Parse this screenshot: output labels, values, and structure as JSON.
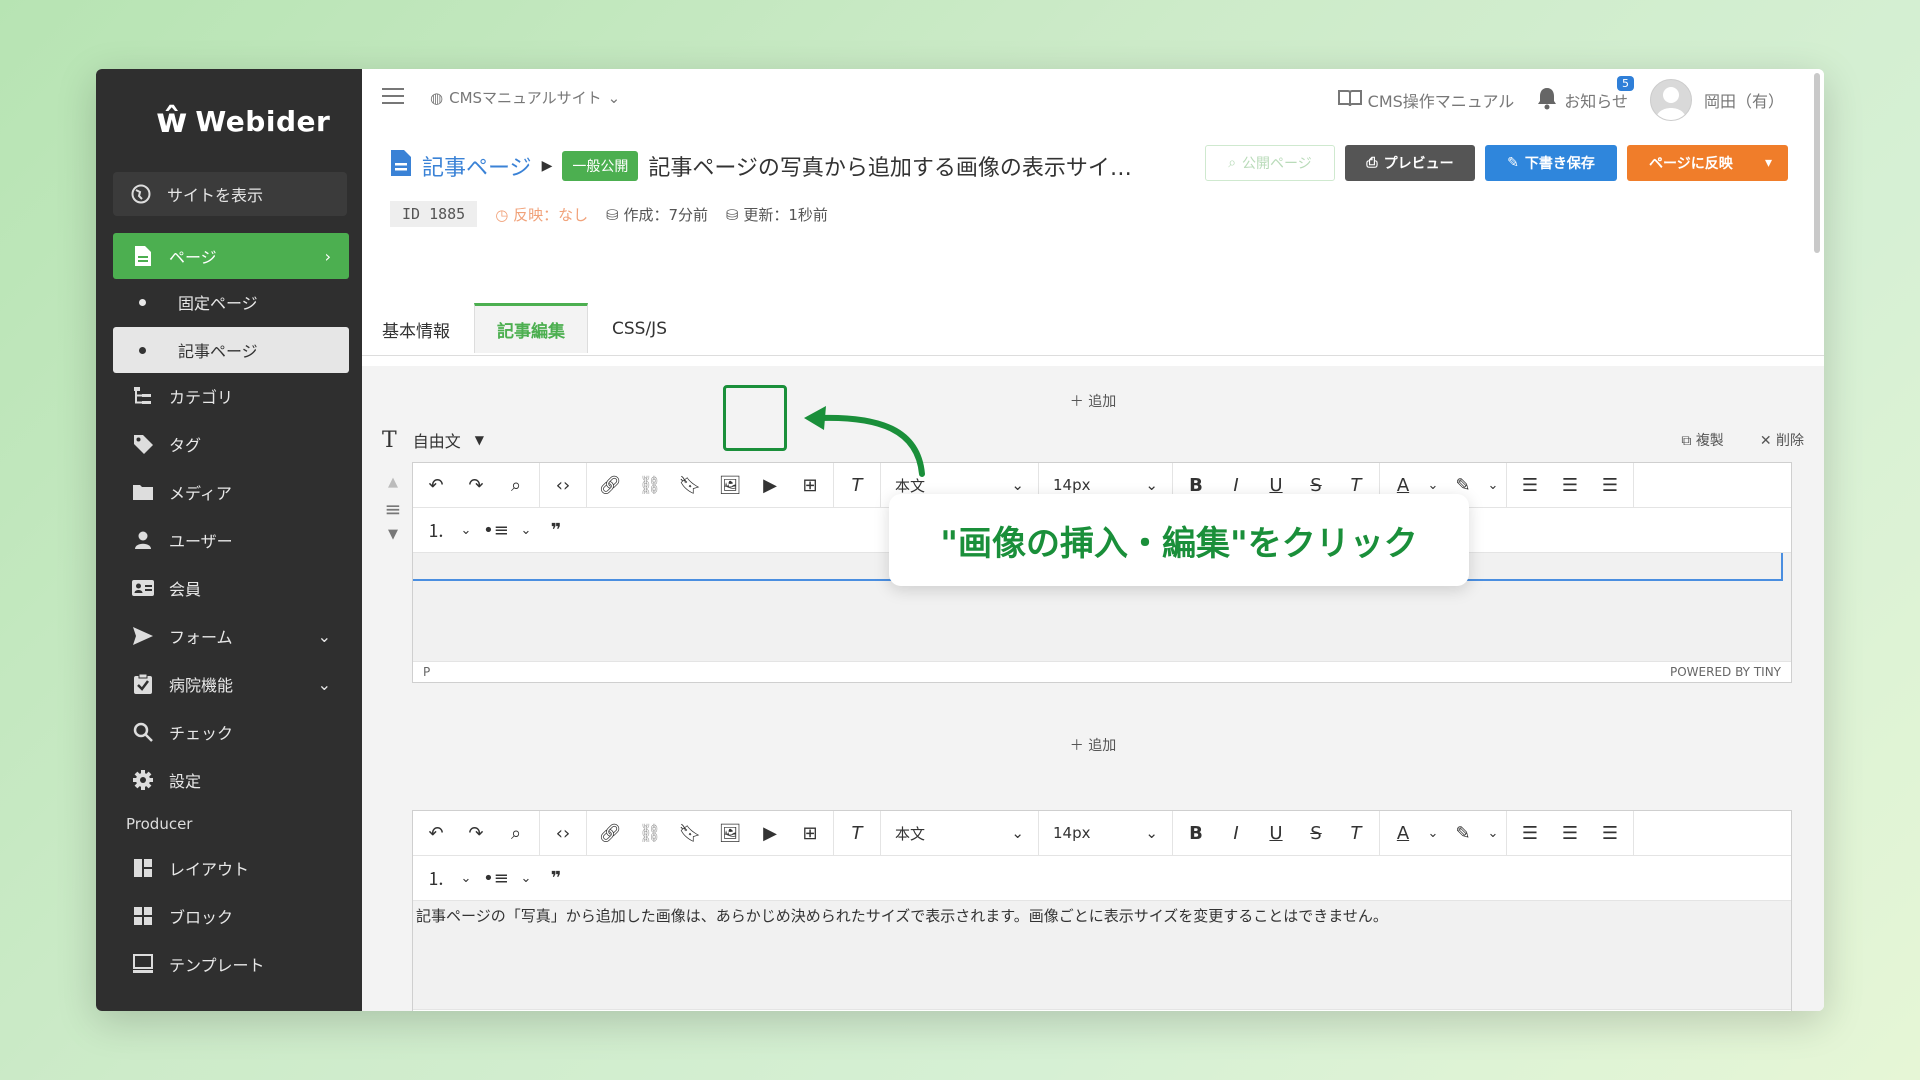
{
  "sidebar": {
    "logo": "Webider",
    "site_button": "サイトを表示",
    "items": [
      {
        "label": "ページ"
      },
      {
        "label": "固定ページ"
      },
      {
        "label": "記事ページ"
      },
      {
        "label": "カテゴリ"
      },
      {
        "label": "タグ"
      },
      {
        "label": "メディア"
      },
      {
        "label": "ユーザー"
      },
      {
        "label": "会員"
      },
      {
        "label": "フォーム"
      },
      {
        "label": "病院機能"
      },
      {
        "label": "チェック"
      },
      {
        "label": "設定"
      }
    ],
    "section": "Producer",
    "producer_items": [
      {
        "label": "レイアウト"
      },
      {
        "label": "ブロック"
      },
      {
        "label": "テンプレート"
      }
    ]
  },
  "topbar": {
    "site": "CMSマニュアルサイト",
    "manual": "CMS操作マニュアル",
    "notice": "お知らせ",
    "notice_count": "5",
    "user": "岡田（有）"
  },
  "header": {
    "breadcrumb": "記事ページ",
    "status_tag": "一般公開",
    "title": "記事ページの写真から追加する画像の表示サイ…",
    "id": "ID 1885",
    "reflect": "反映：なし",
    "created": "作成：7分前",
    "updated": "更新：1秒前",
    "btn_public": "公開ページ",
    "btn_preview": "プレビュー",
    "btn_draft": "下書き保存",
    "btn_reflect": "ページに反映"
  },
  "tabs": [
    {
      "label": "基本情報"
    },
    {
      "label": "記事編集"
    },
    {
      "label": "CSS/JS"
    }
  ],
  "content": {
    "add_label": "追加",
    "block_type": "自由文",
    "copy": "複製",
    "delete": "削除",
    "format_select": "本文",
    "size_select": "14px",
    "status_left": "P",
    "status_right": "POWERED BY TINY",
    "editor2_text": "記事ページの「写真」から追加した画像は、あらかじめ決められたサイズで表示されます。画像ごとに表示サイズを変更することはできません。"
  },
  "callout": "\"画像の挿入・編集\"をクリック",
  "colors": {
    "accent_green": "#4caf50",
    "callout_green": "#1a8f3a",
    "link_blue": "#3a82d6",
    "draft_blue": "#2f86dc",
    "reflect_orange": "#f07d2a",
    "sidebar_bg": "#2f2f2f"
  }
}
